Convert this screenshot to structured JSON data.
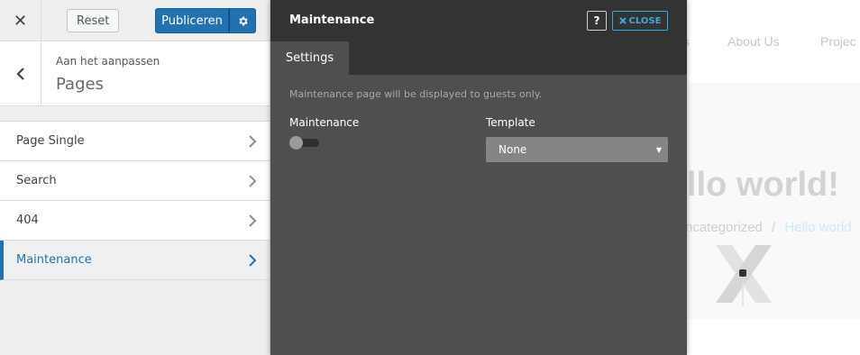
{
  "topbar": {
    "close_glyph": "✕",
    "reset_label": "Reset",
    "publish_label": "Publiceren"
  },
  "section": {
    "customizing_label": "Aan het aanpassen",
    "title": "Pages"
  },
  "panels": [
    {
      "label": "Page Single",
      "active": false
    },
    {
      "label": "Search",
      "active": false
    },
    {
      "label": "404",
      "active": false
    },
    {
      "label": "Maintenance",
      "active": true
    }
  ],
  "preview": {
    "nav": [
      "s",
      "About Us",
      "Projec"
    ],
    "hero_title": "llo world!",
    "breadcrumb_category": "ncategorized",
    "breadcrumb_separator": "/",
    "breadcrumb_post": "Hello world"
  },
  "modal": {
    "title": "Maintenance",
    "help_label": "?",
    "close_label": "CLOSE",
    "tabs": [
      "Settings"
    ],
    "notice": "Maintenance page will be displayed to guests only.",
    "maintenance_label": "Maintenance",
    "maintenance_enabled": false,
    "template_label": "Template",
    "template_value": "None"
  },
  "colors": {
    "accent": "#2271b1",
    "modal_bg": "#4f4f4f",
    "modal_header": "#333333",
    "close_accent": "#3ba7df"
  }
}
